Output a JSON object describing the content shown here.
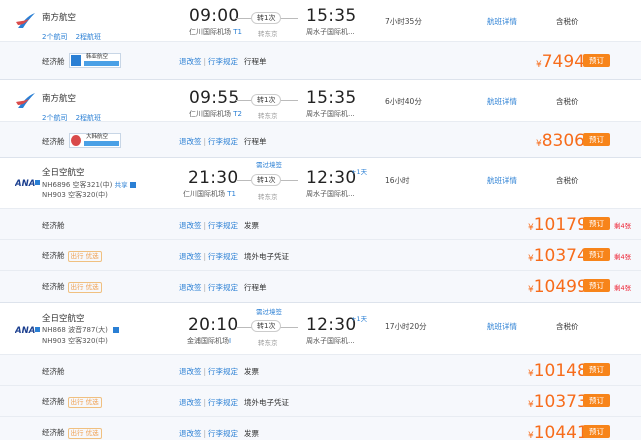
{
  "flights": [
    {
      "airline": "南方航空",
      "sub1": "2个航司",
      "sub2": "2程航班",
      "dep_time": "09:00",
      "dep_airport": "仁川国际机场",
      "dep_terminal": "T1",
      "stop": "转1次",
      "via": "转东京",
      "arr_time": "15:35",
      "arr_airport": "周水子国际机...",
      "duration": "7小时35分",
      "detail": "航班详情",
      "tax": "含税价",
      "logo": "china-southern-logo",
      "fares": [
        {
          "cabin": "经济舱",
          "badge": "韩亚航空",
          "rule1": "退改签",
          "rule2": "行李规定",
          "doc": "行程单",
          "price": "7494",
          "book": "预订",
          "left": ""
        }
      ]
    },
    {
      "airline": "南方航空",
      "sub1": "2个航司",
      "sub2": "2程航班",
      "dep_time": "09:55",
      "dep_airport": "仁川国际机场",
      "dep_terminal": "T2",
      "stop": "转1次",
      "via": "转东京",
      "arr_time": "15:35",
      "arr_airport": "周水子国际机...",
      "duration": "6小时40分",
      "detail": "航班详情",
      "tax": "含税价",
      "logo": "china-southern-logo",
      "fares": [
        {
          "cabin": "经济舱",
          "badge": "大韩航空",
          "rule1": "退改签",
          "rule2": "行李规定",
          "doc": "行程单",
          "price": "8306",
          "book": "预订",
          "left": ""
        }
      ]
    },
    {
      "airline": "全日空航空",
      "flight1": "NH6896 空客321(中)",
      "share": "共享",
      "flight2": "NH903 空客320(中)",
      "direct": "需过境签",
      "dep_time": "21:30",
      "dep_airport": "仁川国际机场",
      "dep_terminal": "T1",
      "stop": "转1次",
      "via": "转东京",
      "arr_time": "12:30",
      "plus_day": "+1天",
      "arr_airport": "周水子国际机...",
      "duration": "16小时",
      "detail": "航班详情",
      "tax": "含税价",
      "logo": "ana-logo",
      "fares": [
        {
          "cabin": "经济舱",
          "tag": "",
          "rule1": "退改签",
          "rule2": "行李规定",
          "doc": "发票",
          "price": "10179",
          "book": "预订",
          "left": "剩4张"
        },
        {
          "cabin": "经济舱",
          "tag": "出行 优选",
          "rule1": "退改签",
          "rule2": "行李规定",
          "doc": "境外电子凭证",
          "price": "10374",
          "book": "预订",
          "left": "剩4张"
        },
        {
          "cabin": "经济舱",
          "tag": "出行 优选",
          "rule1": "退改签",
          "rule2": "行李规定",
          "doc": "行程单",
          "price": "10499",
          "book": "预订",
          "left": "剩4张"
        }
      ]
    },
    {
      "airline": "全日空航空",
      "flight1": "NH868 波音787(大)",
      "flight2": "NH903 空客320(中)",
      "direct": "需过境签",
      "dep_time": "20:10",
      "dep_airport": "金浦国际机场",
      "dep_terminal": "I",
      "stop": "转1次",
      "via": "转东京",
      "arr_time": "12:30",
      "plus_day": "+1天",
      "arr_airport": "周水子国际机...",
      "duration": "17小时20分",
      "detail": "航班详情",
      "tax": "含税价",
      "logo": "ana-logo",
      "fares": [
        {
          "cabin": "经济舱",
          "tag": "",
          "rule1": "退改签",
          "rule2": "行李规定",
          "doc": "发票",
          "price": "10148",
          "book": "预订",
          "left": ""
        },
        {
          "cabin": "经济舱",
          "tag": "出行 优选",
          "rule1": "退改签",
          "rule2": "行李规定",
          "doc": "境外电子凭证",
          "price": "10373",
          "book": "预订",
          "left": ""
        },
        {
          "cabin": "经济舱",
          "tag": "出行 优选",
          "rule1": "退改签",
          "rule2": "行李规定",
          "doc": "发票",
          "price": "10441",
          "book": "预订",
          "left": ""
        }
      ]
    }
  ],
  "currency_symbol": "¥",
  "colors": {
    "accent": "#f7841a",
    "price": "#f76c1b",
    "link": "#2a7fd4"
  }
}
